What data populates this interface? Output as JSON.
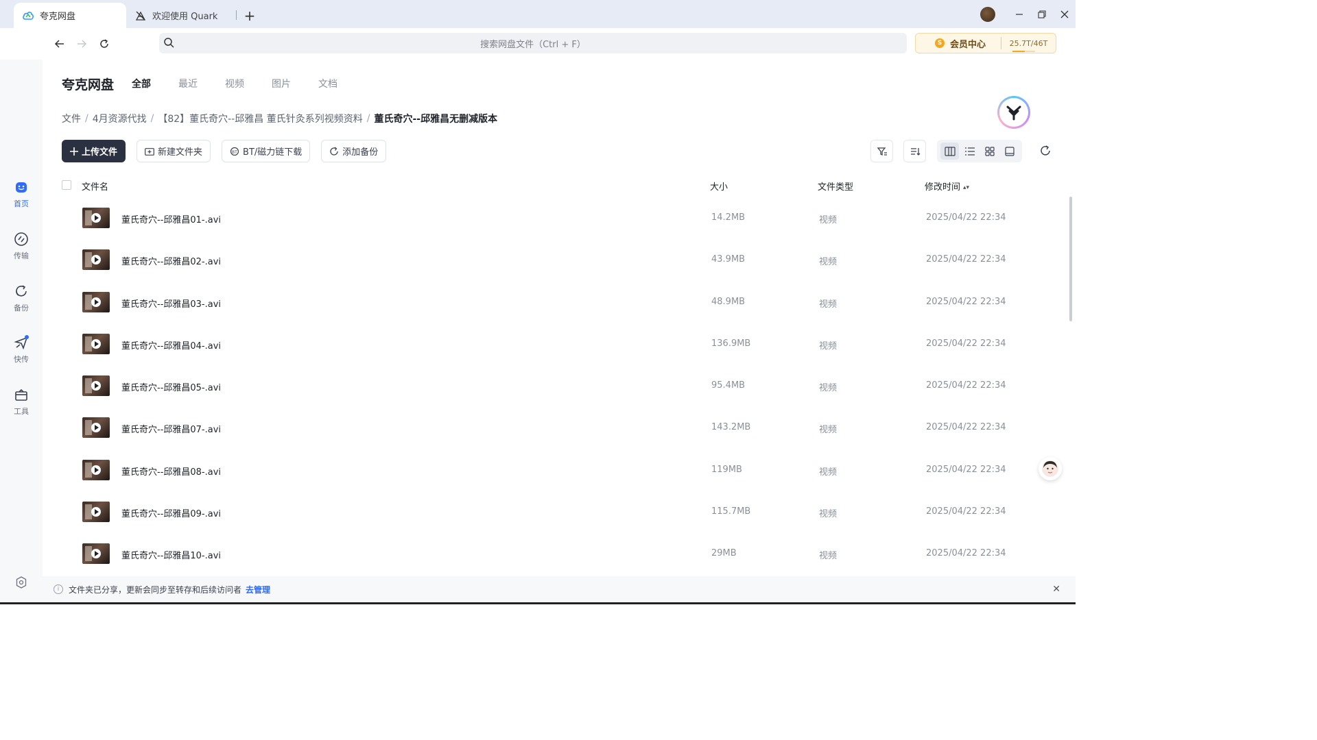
{
  "tabs": [
    {
      "label": "夸克网盘",
      "icon": "cloud-icon",
      "active": true
    },
    {
      "label": "欢迎使用 Quark",
      "icon": "quark-logo-icon",
      "active": false
    }
  ],
  "nav": {
    "search_placeholder": "搜索网盘文件（Ctrl + F）",
    "vip_label": "会员中心",
    "vip_coin": "S",
    "storage": "25.7T/46T",
    "storage_fraction": 0.56
  },
  "sidebar": [
    {
      "label": "首页",
      "icon": "home-icon"
    },
    {
      "label": "传输",
      "icon": "transfer-icon"
    },
    {
      "label": "备份",
      "icon": "backup-icon"
    },
    {
      "label": "快传",
      "icon": "quick-send-icon"
    },
    {
      "label": "工具",
      "icon": "toolbox-icon"
    }
  ],
  "header": {
    "title": "夸克网盘",
    "categories": [
      "全部",
      "最近",
      "视频",
      "图片",
      "文档"
    ]
  },
  "breadcrumb": [
    "文件",
    "4月资源代找",
    "【82】董氏奇穴--邱雅昌 董氏针灸系列视频资料",
    "董氏奇穴--邱雅昌无删减版本"
  ],
  "actions": {
    "upload": "上传文件",
    "new_folder": "新建文件夹",
    "bt": "BT/磁力链下载",
    "backup": "添加备份"
  },
  "table": {
    "headers": {
      "name": "文件名",
      "size": "大小",
      "type": "文件类型",
      "time": "修改时间"
    },
    "rows": [
      {
        "name": "董氏奇穴--邱雅昌01-.avi",
        "size": "14.2MB",
        "type": "视频",
        "time": "2025/04/22 22:34"
      },
      {
        "name": "董氏奇穴--邱雅昌02-.avi",
        "size": "43.9MB",
        "type": "视频",
        "time": "2025/04/22 22:34"
      },
      {
        "name": "董氏奇穴--邱雅昌03-.avi",
        "size": "48.9MB",
        "type": "视频",
        "time": "2025/04/22 22:34"
      },
      {
        "name": "董氏奇穴--邱雅昌04-.avi",
        "size": "136.9MB",
        "type": "视频",
        "time": "2025/04/22 22:34"
      },
      {
        "name": "董氏奇穴--邱雅昌05-.avi",
        "size": "95.4MB",
        "type": "视频",
        "time": "2025/04/22 22:34"
      },
      {
        "name": "董氏奇穴--邱雅昌07-.avi",
        "size": "143.2MB",
        "type": "视频",
        "time": "2025/04/22 22:34"
      },
      {
        "name": "董氏奇穴--邱雅昌08-.avi",
        "size": "119MB",
        "type": "视频",
        "time": "2025/04/22 22:34"
      },
      {
        "name": "董氏奇穴--邱雅昌09-.avi",
        "size": "115.7MB",
        "type": "视频",
        "time": "2025/04/22 22:34"
      },
      {
        "name": "董氏奇穴--邱雅昌10-.avi",
        "size": "29MB",
        "type": "视频",
        "time": "2025/04/22 22:34"
      }
    ]
  },
  "notice": {
    "text": "文件夹已分享，更新会同步至转存和后续访问者",
    "link": "去管理"
  },
  "colors": {
    "accent": "#2f6bff",
    "primary_button": "#2b3140",
    "vip": "#f5a623"
  }
}
